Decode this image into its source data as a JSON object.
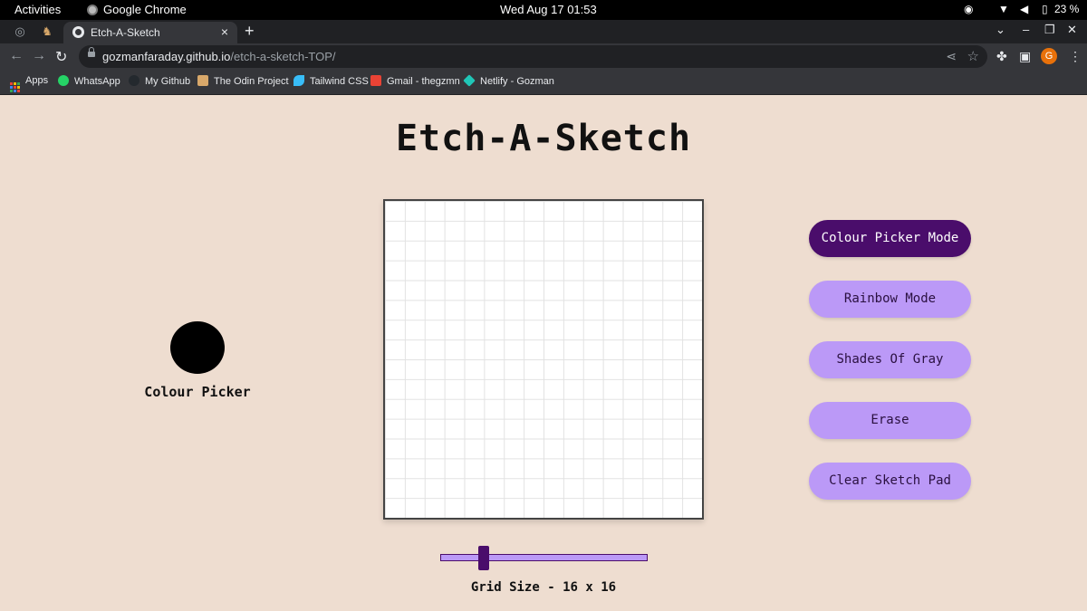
{
  "os_bar": {
    "activities": "Activities",
    "app_name": "Google Chrome",
    "datetime": "Wed Aug 17  01:53",
    "battery": "23 %"
  },
  "browser": {
    "tab_title": "Etch-A-Sketch",
    "url_host": "gozmanfaraday.github.io",
    "url_path": "/etch-a-sketch-TOP/",
    "profile_initial": "G",
    "bookmarks": [
      {
        "label": "Apps",
        "icon": "apps-grid-icon"
      },
      {
        "label": "WhatsApp",
        "icon": "whatsapp-icon",
        "color": "#25d366"
      },
      {
        "label": "My Github",
        "icon": "github-icon",
        "color": "#24292e"
      },
      {
        "label": "The Odin Project",
        "icon": "odin-icon",
        "color": "#d8a86a"
      },
      {
        "label": "Tailwind CSS",
        "icon": "tailwind-icon",
        "color": "#38bdf8"
      },
      {
        "label": "Gmail - thegzmn",
        "icon": "gmail-icon",
        "color": "#ea4335"
      },
      {
        "label": "Netlify - Gozman",
        "icon": "netlify-icon",
        "color": "#20c6b7"
      }
    ]
  },
  "app": {
    "title": "Etch-A-Sketch",
    "colour_picker": {
      "label": "Colour Picker",
      "value": "#000000"
    },
    "grid": {
      "rows": 16,
      "cols": 16
    },
    "modes": [
      {
        "label": "Colour Picker Mode",
        "active": true
      },
      {
        "label": "Rainbow Mode",
        "active": false
      },
      {
        "label": "Shades Of Gray",
        "active": false
      },
      {
        "label": "Erase",
        "active": false
      },
      {
        "label": "Clear Sketch Pad",
        "active": false
      }
    ],
    "grid_size_label": "Grid Size - 16 x 16",
    "colors": {
      "accent": "#4a0d6b",
      "button": "#bb99f7",
      "background": "#eeddd0"
    }
  }
}
